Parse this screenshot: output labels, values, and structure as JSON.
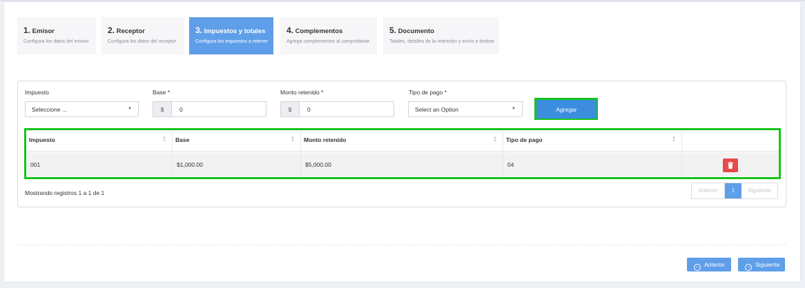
{
  "steps": [
    {
      "num": "1.",
      "title": "Emisor",
      "subtitle": "Configura los datos del emisor"
    },
    {
      "num": "2.",
      "title": "Receptor",
      "subtitle": "Configura los datos del receptor"
    },
    {
      "num": "3.",
      "title": "Impuestos y totales",
      "subtitle": "Configura los impuestos a retener"
    },
    {
      "num": "4.",
      "title": "Complementos",
      "subtitle": "Agrega complementos al comprobante"
    },
    {
      "num": "5.",
      "title": "Documento",
      "subtitle": "Totales, detalles de la retención y envío a timbrar"
    }
  ],
  "form": {
    "impuesto_label": "Impuesto",
    "impuesto_value": "Seleccione ...",
    "base_label": "Base *",
    "base_prefix": "$",
    "base_value": "0",
    "monto_label": "Monto retenido *",
    "monto_prefix": "$",
    "monto_value": "0",
    "tipo_label": "Tipo de pago *",
    "tipo_value": "Select an Option",
    "add_button": "Agregar"
  },
  "table": {
    "headers": [
      "Impuesto",
      "Base",
      "Monto retenido",
      "Tipo de pago"
    ],
    "rows": [
      [
        "001",
        "$1,000.00",
        "$5,000.00",
        "04"
      ]
    ]
  },
  "pagination": {
    "info": "Mostrando registros 1 a 1 de 1",
    "prev": "Anterior",
    "page": "1",
    "next": "Siguiente"
  },
  "footer": {
    "prev_button": "Anterior",
    "next_button": "Siguiente"
  },
  "colors": {
    "accent": "#5f9ee9",
    "primary_button": "#3d8ddf",
    "delete": "#e84a4a",
    "highlight": "#14c41a"
  },
  "icons": {
    "delete": "trash-icon",
    "prev": "arrow-left-circle-icon",
    "next": "arrow-right-circle-icon",
    "sort": "sort-icon",
    "dropdown": "caret-down-icon"
  }
}
